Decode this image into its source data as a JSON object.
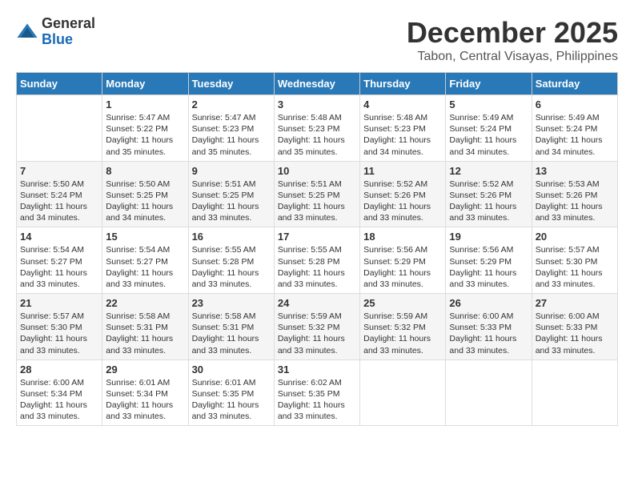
{
  "logo": {
    "general": "General",
    "blue": "Blue"
  },
  "title": {
    "month": "December 2025",
    "location": "Tabon, Central Visayas, Philippines"
  },
  "headers": [
    "Sunday",
    "Monday",
    "Tuesday",
    "Wednesday",
    "Thursday",
    "Friday",
    "Saturday"
  ],
  "weeks": [
    [
      {
        "day": "",
        "sunrise": "",
        "sunset": "",
        "daylight": ""
      },
      {
        "day": "1",
        "sunrise": "Sunrise: 5:47 AM",
        "sunset": "Sunset: 5:22 PM",
        "daylight": "Daylight: 11 hours and 35 minutes."
      },
      {
        "day": "2",
        "sunrise": "Sunrise: 5:47 AM",
        "sunset": "Sunset: 5:23 PM",
        "daylight": "Daylight: 11 hours and 35 minutes."
      },
      {
        "day": "3",
        "sunrise": "Sunrise: 5:48 AM",
        "sunset": "Sunset: 5:23 PM",
        "daylight": "Daylight: 11 hours and 35 minutes."
      },
      {
        "day": "4",
        "sunrise": "Sunrise: 5:48 AM",
        "sunset": "Sunset: 5:23 PM",
        "daylight": "Daylight: 11 hours and 34 minutes."
      },
      {
        "day": "5",
        "sunrise": "Sunrise: 5:49 AM",
        "sunset": "Sunset: 5:24 PM",
        "daylight": "Daylight: 11 hours and 34 minutes."
      },
      {
        "day": "6",
        "sunrise": "Sunrise: 5:49 AM",
        "sunset": "Sunset: 5:24 PM",
        "daylight": "Daylight: 11 hours and 34 minutes."
      }
    ],
    [
      {
        "day": "7",
        "sunrise": "Sunrise: 5:50 AM",
        "sunset": "Sunset: 5:24 PM",
        "daylight": "Daylight: 11 hours and 34 minutes."
      },
      {
        "day": "8",
        "sunrise": "Sunrise: 5:50 AM",
        "sunset": "Sunset: 5:25 PM",
        "daylight": "Daylight: 11 hours and 34 minutes."
      },
      {
        "day": "9",
        "sunrise": "Sunrise: 5:51 AM",
        "sunset": "Sunset: 5:25 PM",
        "daylight": "Daylight: 11 hours and 33 minutes."
      },
      {
        "day": "10",
        "sunrise": "Sunrise: 5:51 AM",
        "sunset": "Sunset: 5:25 PM",
        "daylight": "Daylight: 11 hours and 33 minutes."
      },
      {
        "day": "11",
        "sunrise": "Sunrise: 5:52 AM",
        "sunset": "Sunset: 5:26 PM",
        "daylight": "Daylight: 11 hours and 33 minutes."
      },
      {
        "day": "12",
        "sunrise": "Sunrise: 5:52 AM",
        "sunset": "Sunset: 5:26 PM",
        "daylight": "Daylight: 11 hours and 33 minutes."
      },
      {
        "day": "13",
        "sunrise": "Sunrise: 5:53 AM",
        "sunset": "Sunset: 5:26 PM",
        "daylight": "Daylight: 11 hours and 33 minutes."
      }
    ],
    [
      {
        "day": "14",
        "sunrise": "Sunrise: 5:54 AM",
        "sunset": "Sunset: 5:27 PM",
        "daylight": "Daylight: 11 hours and 33 minutes."
      },
      {
        "day": "15",
        "sunrise": "Sunrise: 5:54 AM",
        "sunset": "Sunset: 5:27 PM",
        "daylight": "Daylight: 11 hours and 33 minutes."
      },
      {
        "day": "16",
        "sunrise": "Sunrise: 5:55 AM",
        "sunset": "Sunset: 5:28 PM",
        "daylight": "Daylight: 11 hours and 33 minutes."
      },
      {
        "day": "17",
        "sunrise": "Sunrise: 5:55 AM",
        "sunset": "Sunset: 5:28 PM",
        "daylight": "Daylight: 11 hours and 33 minutes."
      },
      {
        "day": "18",
        "sunrise": "Sunrise: 5:56 AM",
        "sunset": "Sunset: 5:29 PM",
        "daylight": "Daylight: 11 hours and 33 minutes."
      },
      {
        "day": "19",
        "sunrise": "Sunrise: 5:56 AM",
        "sunset": "Sunset: 5:29 PM",
        "daylight": "Daylight: 11 hours and 33 minutes."
      },
      {
        "day": "20",
        "sunrise": "Sunrise: 5:57 AM",
        "sunset": "Sunset: 5:30 PM",
        "daylight": "Daylight: 11 hours and 33 minutes."
      }
    ],
    [
      {
        "day": "21",
        "sunrise": "Sunrise: 5:57 AM",
        "sunset": "Sunset: 5:30 PM",
        "daylight": "Daylight: 11 hours and 33 minutes."
      },
      {
        "day": "22",
        "sunrise": "Sunrise: 5:58 AM",
        "sunset": "Sunset: 5:31 PM",
        "daylight": "Daylight: 11 hours and 33 minutes."
      },
      {
        "day": "23",
        "sunrise": "Sunrise: 5:58 AM",
        "sunset": "Sunset: 5:31 PM",
        "daylight": "Daylight: 11 hours and 33 minutes."
      },
      {
        "day": "24",
        "sunrise": "Sunrise: 5:59 AM",
        "sunset": "Sunset: 5:32 PM",
        "daylight": "Daylight: 11 hours and 33 minutes."
      },
      {
        "day": "25",
        "sunrise": "Sunrise: 5:59 AM",
        "sunset": "Sunset: 5:32 PM",
        "daylight": "Daylight: 11 hours and 33 minutes."
      },
      {
        "day": "26",
        "sunrise": "Sunrise: 6:00 AM",
        "sunset": "Sunset: 5:33 PM",
        "daylight": "Daylight: 11 hours and 33 minutes."
      },
      {
        "day": "27",
        "sunrise": "Sunrise: 6:00 AM",
        "sunset": "Sunset: 5:33 PM",
        "daylight": "Daylight: 11 hours and 33 minutes."
      }
    ],
    [
      {
        "day": "28",
        "sunrise": "Sunrise: 6:00 AM",
        "sunset": "Sunset: 5:34 PM",
        "daylight": "Daylight: 11 hours and 33 minutes."
      },
      {
        "day": "29",
        "sunrise": "Sunrise: 6:01 AM",
        "sunset": "Sunset: 5:34 PM",
        "daylight": "Daylight: 11 hours and 33 minutes."
      },
      {
        "day": "30",
        "sunrise": "Sunrise: 6:01 AM",
        "sunset": "Sunset: 5:35 PM",
        "daylight": "Daylight: 11 hours and 33 minutes."
      },
      {
        "day": "31",
        "sunrise": "Sunrise: 6:02 AM",
        "sunset": "Sunset: 5:35 PM",
        "daylight": "Daylight: 11 hours and 33 minutes."
      },
      {
        "day": "",
        "sunrise": "",
        "sunset": "",
        "daylight": ""
      },
      {
        "day": "",
        "sunrise": "",
        "sunset": "",
        "daylight": ""
      },
      {
        "day": "",
        "sunrise": "",
        "sunset": "",
        "daylight": ""
      }
    ]
  ]
}
